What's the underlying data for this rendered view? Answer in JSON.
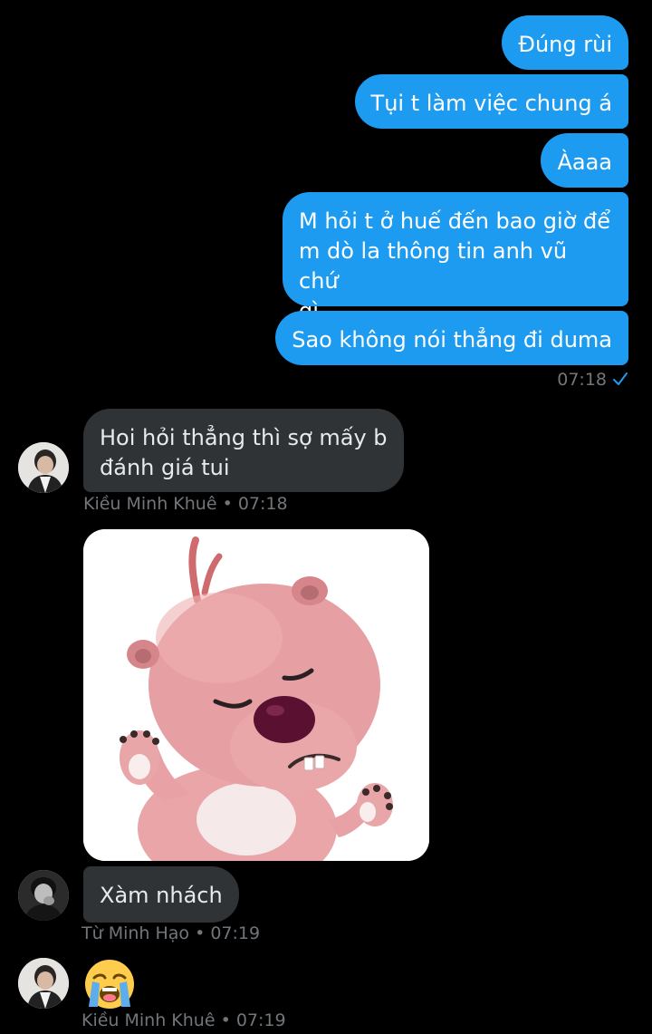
{
  "outgoing_messages": [
    {
      "text": "Đúng rùi"
    },
    {
      "text": "Tụi t làm việc chung á"
    },
    {
      "text": "Àaaa"
    },
    {
      "text": "M hỏi t ở huế đến bao giờ để\nm dò la thông tin anh vũ chứ\ngì"
    },
    {
      "text": "Sao không nói thẳng đi duma"
    }
  ],
  "outgoing_time": "07:18",
  "incoming": [
    {
      "text": "Hoi hỏi thẳng thì sợ mấy b\nđánh giá tui",
      "meta": "Kiều Minh Khuê • 07:18"
    },
    {
      "text": "Xàm nhách",
      "meta": "Từ Minh Hạo • 07:19"
    },
    {
      "emoji": "loudly-crying-face",
      "meta": "Kiều Minh Khuê • 07:19"
    }
  ],
  "sticker": {
    "subject": "pink beaver sticker"
  },
  "colors": {
    "background": "#000000",
    "outgoing_bubble": "#1d9bf0",
    "incoming_bubble": "#2f3336",
    "meta_text": "#71767b",
    "read_check": "#1d9bf0"
  }
}
